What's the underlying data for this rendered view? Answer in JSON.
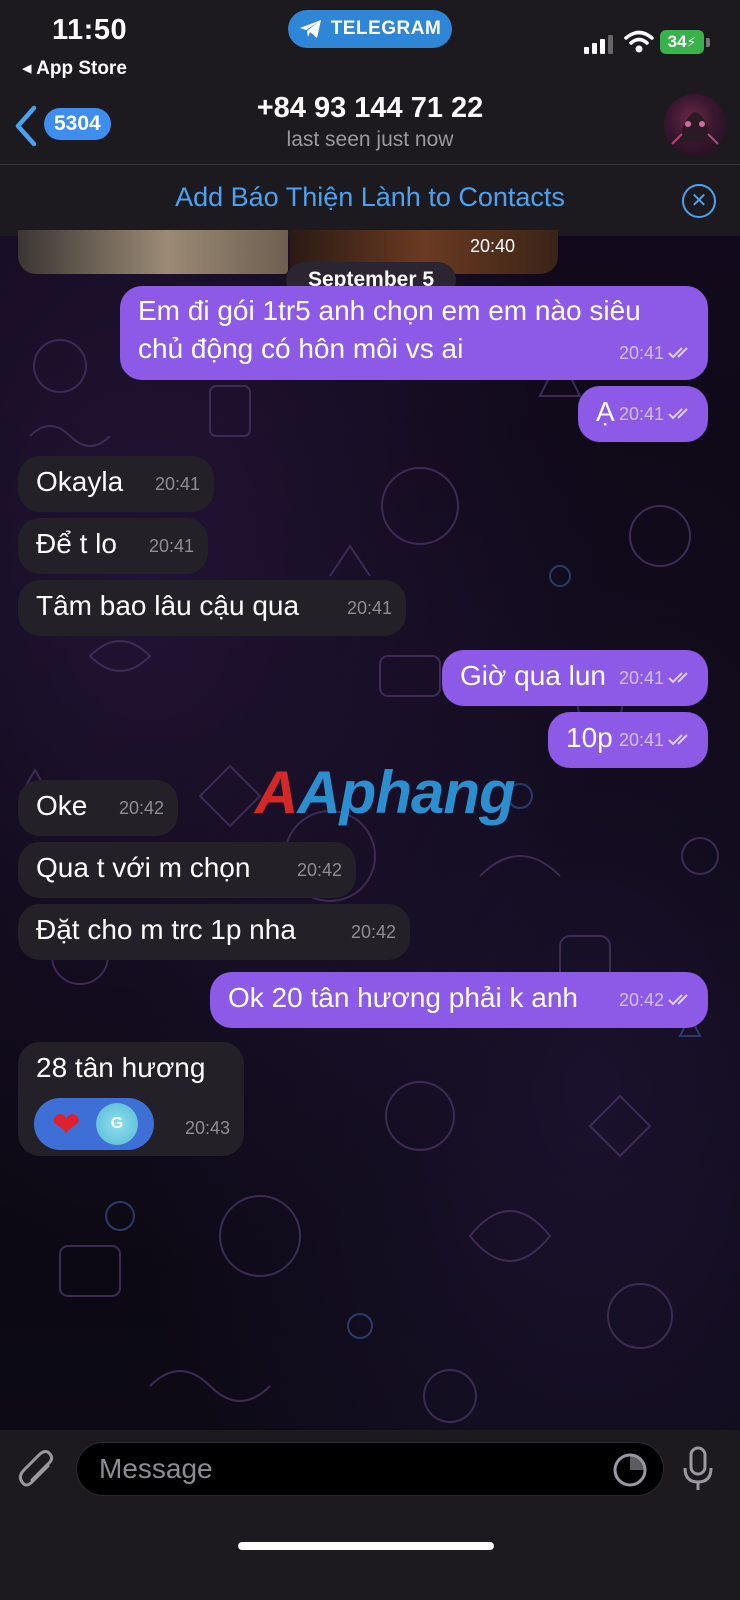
{
  "status_bar": {
    "time": "11:50",
    "back_app": "◂ App Store",
    "telegram_pill": "TELEGRAM",
    "battery": "34"
  },
  "header": {
    "back_badge": "5304",
    "title": "+84 93 144 71 22",
    "subtitle": "last seen just now"
  },
  "banner": {
    "add_contact": "Add Báo Thiện Lành to Contacts"
  },
  "media": {
    "time": "20:40"
  },
  "date_separator": "September 5",
  "messages": [
    {
      "dir": "out",
      "text_line1": "Em đi gói 1tr5 anh chọn em em nào siêu",
      "text_line2": "chủ động có hôn môi vs ai",
      "time": "20:41",
      "read": true
    },
    {
      "dir": "out",
      "text": "Ạ",
      "time": "20:41",
      "read": true
    },
    {
      "dir": "in",
      "text": "Okayla",
      "time": "20:41"
    },
    {
      "dir": "in",
      "text": "Để t lo",
      "time": "20:41"
    },
    {
      "dir": "in",
      "text": "Tâm bao lâu cậu qua",
      "time": "20:41"
    },
    {
      "dir": "out",
      "text": "Giờ qua lun",
      "time": "20:41",
      "read": true
    },
    {
      "dir": "out",
      "text": "10p",
      "time": "20:41",
      "read": true
    },
    {
      "dir": "in",
      "text": "Oke",
      "time": "20:42"
    },
    {
      "dir": "in",
      "text": "Qua t với m chọn",
      "time": "20:42"
    },
    {
      "dir": "in",
      "text": "Đặt cho m trc 1p nha",
      "time": "20:42"
    },
    {
      "dir": "out",
      "text": "Ok 20 tân hương phải k anh",
      "time": "20:42",
      "read": true
    },
    {
      "dir": "in",
      "text": "28 tân hương",
      "time": "20:43",
      "reaction": "heart",
      "reaction_user": "G"
    }
  ],
  "watermark": "Aphang",
  "input": {
    "placeholder": "Message"
  },
  "colors": {
    "outgoing_bubble": "#8d5ae8",
    "incoming_bubble": "#232028",
    "accent": "#4aa3f2",
    "telegram_pill": "#2f86d6",
    "battery": "#38b24a"
  },
  "icons": [
    "telegram-plane-icon",
    "cellular-signal-icon",
    "wifi-icon",
    "battery-charging-icon",
    "back-chevron-icon",
    "close-circle-icon",
    "double-check-icon",
    "heart-icon",
    "attach-paperclip-icon",
    "sticker-clock-icon",
    "microphone-icon"
  ]
}
